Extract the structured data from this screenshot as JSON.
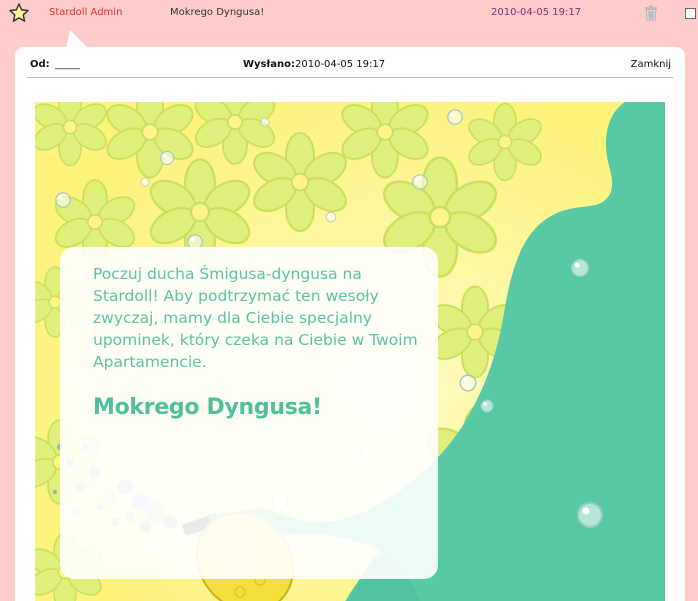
{
  "header": {
    "sender": "Stardoll Admin",
    "subject": "Mokrego Dyngusa!",
    "date": "2010-04-05 19:17"
  },
  "message": {
    "from_label": "Od:",
    "from_value": "_____",
    "sent_label": "Wysłano:",
    "sent_value": "2010-04-05 19:17",
    "close_label": "Zamknij"
  },
  "card": {
    "body_text": "Poczuj ducha Śmigusa-dyngusa na Stardoll! Aby podtrzymać ten wesoły zwyczaj, mamy dla Ciebie specjalny upominek, który czeka na Ciebie w Twoim Apartamencie.",
    "heading": "Mokrego Dyngusa!"
  },
  "icons": {
    "star": "star-icon",
    "trash": "trash-icon"
  },
  "colors": {
    "background": "#ffcccc",
    "sender": "#e0302f",
    "date": "#8a2e7c",
    "card_yellow": "#fff88a",
    "silhouette": "#57c9a5",
    "text_green": "#5ac3a4"
  }
}
